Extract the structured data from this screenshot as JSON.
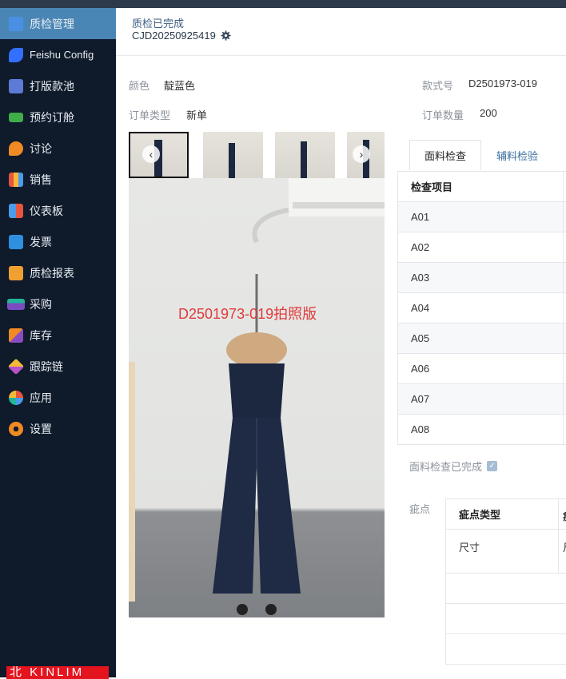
{
  "sidebar": {
    "items": [
      {
        "label": "质检管理",
        "icon": "qc-doc-icon",
        "color": "#4a90e2",
        "active": true
      },
      {
        "label": "Feishu Config",
        "icon": "feishu-icon",
        "color": "#3370ff"
      },
      {
        "label": "打版款池",
        "icon": "sample-pool-icon",
        "color": "#5b7bd5"
      },
      {
        "label": "预约订舱",
        "icon": "ship-icon",
        "color": "#3fae49"
      },
      {
        "label": "讨论",
        "icon": "chat-icon",
        "color": "#f08a24"
      },
      {
        "label": "销售",
        "icon": "bar-chart-icon",
        "color": "#e8553e"
      },
      {
        "label": "仪表板",
        "icon": "dashboard-icon",
        "color": "#4a9be8"
      },
      {
        "label": "发票",
        "icon": "invoice-icon",
        "color": "#2f8fe0"
      },
      {
        "label": "质检报表",
        "icon": "report-icon",
        "color": "#f0a030"
      },
      {
        "label": "采购",
        "icon": "purchase-icon",
        "color": "#22b59a"
      },
      {
        "label": "库存",
        "icon": "inventory-icon",
        "color": "#f08a24"
      },
      {
        "label": "跟踪链",
        "icon": "trace-chain-icon",
        "color": "#f5b93a"
      },
      {
        "label": "应用",
        "icon": "apps-icon",
        "color": "#e8553e"
      },
      {
        "label": "设置",
        "icon": "settings-icon",
        "color": "#f08a24"
      }
    ],
    "brand": "北 KINLIM"
  },
  "header": {
    "status": "质检已完成",
    "code": "CJD20250925419"
  },
  "info": {
    "color_label": "颜色",
    "color_value": "靛蓝色",
    "style_label": "款式号",
    "style_value": "D2501973-019",
    "order_type_label": "订单类型",
    "order_type_value": "新单",
    "order_qty_label": "订单数量",
    "order_qty_value": "200"
  },
  "photo": {
    "caption": "D2501973-019拍照版"
  },
  "tabs": [
    {
      "label": "面料检查",
      "active": true
    },
    {
      "label": "辅料检验",
      "active": false
    }
  ],
  "inspection_table": {
    "header": "检查项目",
    "rows": [
      "A01",
      "A02",
      "A03",
      "A04",
      "A05",
      "A06",
      "A07",
      "A08"
    ]
  },
  "fabric_done": {
    "label": "面料检查已完成",
    "checked": true
  },
  "defects": {
    "label": "疵点",
    "header": "疵点类型",
    "header_cut": "疵",
    "rows": [
      {
        "type": "尺寸",
        "cut": "尺"
      },
      {
        "type": "",
        "cut": ""
      },
      {
        "type": "",
        "cut": ""
      },
      {
        "type": "",
        "cut": ""
      }
    ]
  }
}
